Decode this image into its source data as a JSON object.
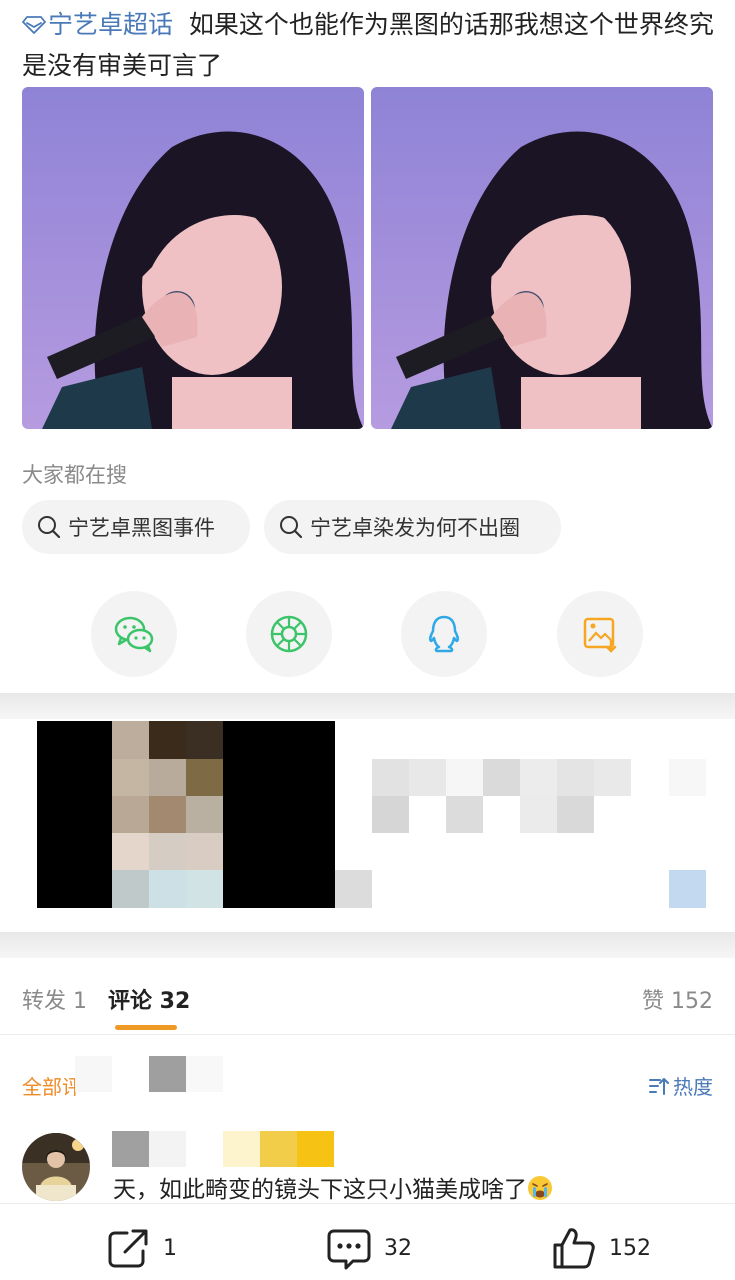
{
  "post": {
    "topic": "宁艺卓超话",
    "text": "如果这个也能作为黑图的话那我想这个世界终究是没有审美可言了"
  },
  "search": {
    "heading": "大家都在搜",
    "chips": [
      "宁艺卓黑图事件",
      "宁艺卓染发为何不出圈"
    ]
  },
  "share": {
    "icons": [
      "wechat-icon",
      "moments-icon",
      "qq-icon",
      "save-image-icon"
    ]
  },
  "tabs": {
    "repost": "转发 1",
    "comment": "评论 32",
    "like": "赞 152"
  },
  "comments": {
    "filter": "全部评",
    "sort": "热度",
    "items": [
      {
        "text": "天，如此畸变的镜头下这只小猫美成啥了"
      }
    ]
  },
  "bottom_bar": {
    "repost_count": "1",
    "comment_count": "32",
    "like_count": "152"
  },
  "colors": {
    "link": "#4a79b8",
    "accent": "#f09a26",
    "chip_bg": "#f3f3f3"
  }
}
